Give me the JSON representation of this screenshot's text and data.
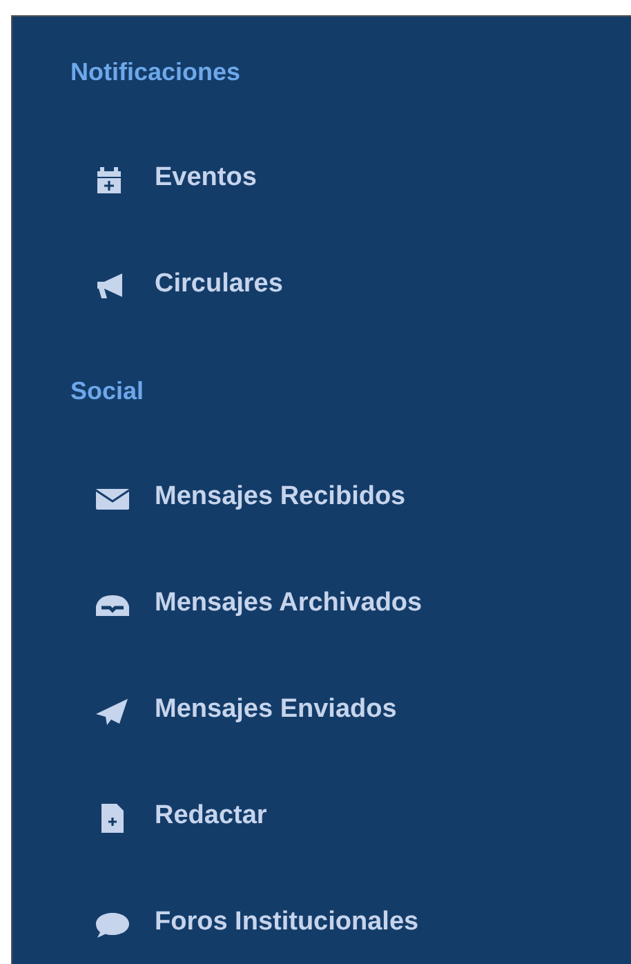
{
  "sections": [
    {
      "heading": "Notificaciones",
      "items": [
        {
          "label": "Eventos"
        },
        {
          "label": "Circulares"
        }
      ]
    },
    {
      "heading": "Social",
      "items": [
        {
          "label": "Mensajes Recibidos"
        },
        {
          "label": "Mensajes Archivados"
        },
        {
          "label": "Mensajes Enviados"
        },
        {
          "label": "Redactar"
        },
        {
          "label": "Foros Institucionales"
        }
      ]
    }
  ]
}
